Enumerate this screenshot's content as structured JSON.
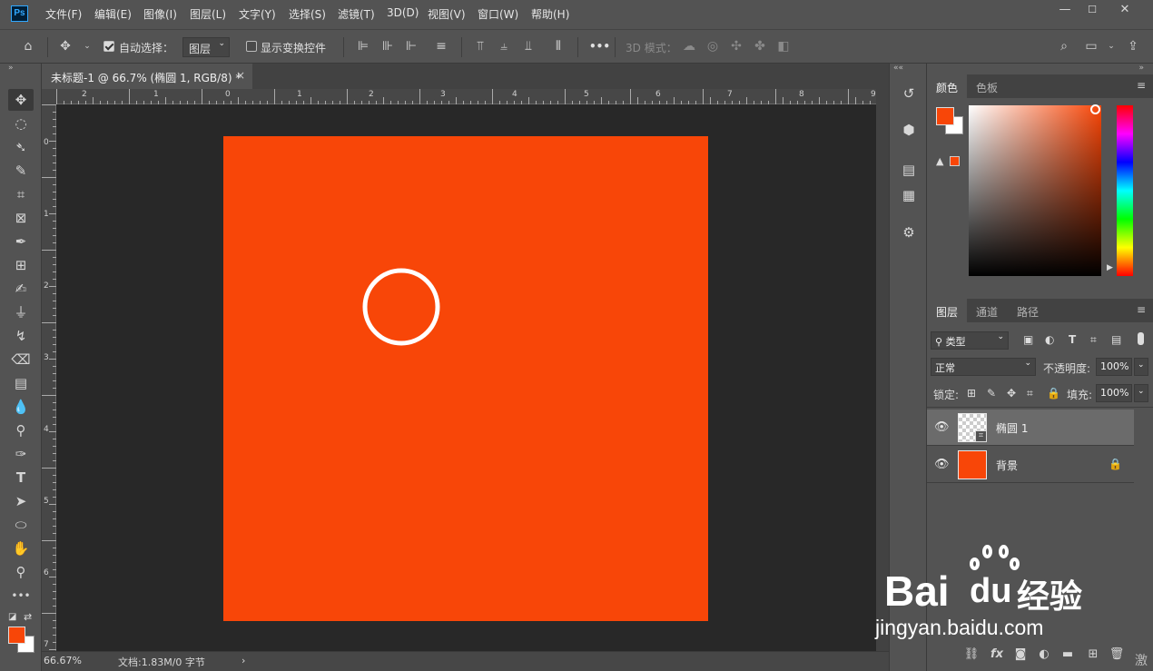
{
  "app": {
    "logo_text": "Ps"
  },
  "menu": [
    "文件(F)",
    "编辑(E)",
    "图像(I)",
    "图层(L)",
    "文字(Y)",
    "选择(S)",
    "滤镜(T)",
    "3D(D)",
    "视图(V)",
    "窗口(W)",
    "帮助(H)"
  ],
  "window_controls": {
    "minimize": "—",
    "maximize": "☐",
    "close": "✕"
  },
  "options": {
    "auto_select_label": "自动选择：",
    "auto_select_checked": true,
    "auto_select_target": "图层",
    "show_transform_label": "显示变换控件",
    "show_transform_checked": false,
    "three_d_mode_label": "3D 模式：",
    "more": "•••"
  },
  "document": {
    "tab_title": "未标题-1 @ 66.7% (椭圆 1, RGB/8) *",
    "tab_close": "×",
    "canvas_color": "#f84608",
    "shape": "circle",
    "circle_stroke": "#ffffff"
  },
  "rulers": {
    "top": [
      "2",
      "1",
      "0",
      "1",
      "2",
      "3",
      "4",
      "5",
      "6",
      "7",
      "8",
      "9"
    ],
    "left": [
      "0",
      "1",
      "2",
      "3",
      "4",
      "5",
      "6",
      "7"
    ]
  },
  "status": {
    "zoom": "66.67%",
    "doc_info": "文档:1.83M/0 字节",
    "arrow": "›"
  },
  "colors": {
    "foreground": "#f84608",
    "background": "#ffffff"
  },
  "color_panel": {
    "tabs": [
      "颜色",
      "色板"
    ],
    "menu": "≡",
    "warning": "▲"
  },
  "layers_panel": {
    "tabs": [
      "图层",
      "通道",
      "路径"
    ],
    "menu": "≡",
    "filter_kind": "类型",
    "blend_mode": "正常",
    "opacity_label": "不透明度:",
    "opacity_value": "100%",
    "lock_label": "锁定:",
    "fill_label": "填充:",
    "fill_value": "100%",
    "layers": [
      {
        "name": "椭圆 1",
        "selected": true,
        "locked": false,
        "thumb": "transparent"
      },
      {
        "name": "背景",
        "selected": false,
        "locked": true,
        "thumb": "#f84608"
      }
    ],
    "bottom_icons": [
      "link-icon",
      "fx-icon",
      "mask-icon",
      "adjustment-icon",
      "folder-icon",
      "new-layer-icon",
      "trash-icon"
    ],
    "fx_text": "fx"
  },
  "watermark": {
    "brand": "Bai",
    "brand2": "du",
    "brand_cn": "经验",
    "url": "jingyan.baidu.com",
    "corner": "激"
  }
}
